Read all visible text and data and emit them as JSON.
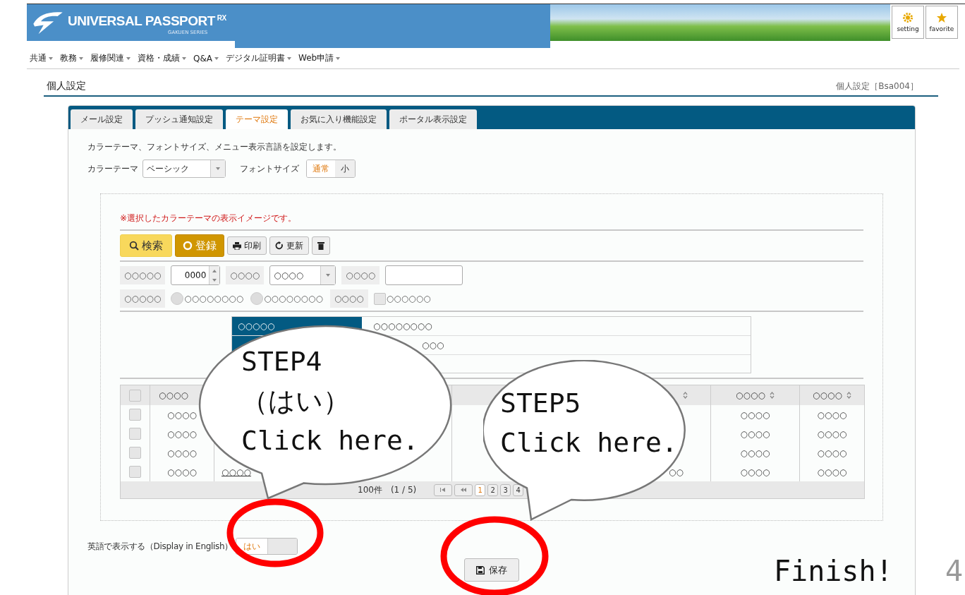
{
  "header": {
    "logo": "UNIVERSAL PASSPORT",
    "logo_sup": "RX",
    "logo_sub": "GAKUEN SERIES",
    "buttons": [
      {
        "label": "setting",
        "kind": "gear"
      },
      {
        "label": "favorite",
        "kind": "star"
      }
    ]
  },
  "menu": [
    "共通",
    "教務",
    "履修関連",
    "資格・成績",
    "Q&A",
    "デジタル証明書",
    "Web申請"
  ],
  "page": {
    "title": "個人設定",
    "screen_id": "個人設定［Bsa004］"
  },
  "tabs": [
    {
      "label": "メール設定",
      "selected": false
    },
    {
      "label": "プッシュ通知設定",
      "selected": false
    },
    {
      "label": "テーマ設定",
      "selected": true
    },
    {
      "label": "お気に入り機能設定",
      "selected": false
    },
    {
      "label": "ポータル表示設定",
      "selected": false
    }
  ],
  "description": "カラーテーマ、フォントサイズ、メニュー表示言語を設定します。",
  "color_theme": {
    "label": "カラーテーマ",
    "value": "ベーシック"
  },
  "font_size": {
    "label": "フォントサイズ",
    "options": [
      {
        "label": "通常",
        "selected": true
      },
      {
        "label": "小",
        "selected": false
      }
    ]
  },
  "preview": {
    "note": "※選択したカラーテーマの表示イメージです。",
    "buttons": [
      {
        "label": "検索",
        "kind": "search"
      },
      {
        "label": "登録",
        "kind": "register"
      },
      {
        "label": "印刷",
        "kind": "print"
      },
      {
        "label": "更新",
        "kind": "refresh"
      },
      {
        "kind": "delete"
      }
    ],
    "form_rows": [
      [
        {
          "kind": "label",
          "text": "○○○○○"
        },
        {
          "kind": "number",
          "text": "0000"
        },
        {
          "kind": "label",
          "text": "○○○○"
        },
        {
          "kind": "select",
          "text": "○○○○"
        },
        {
          "kind": "label",
          "text": "○○○○"
        },
        {
          "kind": "input"
        }
      ],
      [
        {
          "kind": "label",
          "text": "○○○○○"
        },
        {
          "kind": "radio",
          "text": "○○○○○○○○",
          "checked": false
        },
        {
          "kind": "radio",
          "text": "○○○○○○○○",
          "checked": false
        },
        {
          "kind": "label",
          "text": "○○○○"
        },
        {
          "kind": "checkbox",
          "text": "○○○○○○",
          "checked": false
        }
      ]
    ],
    "detail_table": [
      {
        "label": "○○○○○",
        "value": "○○○○○○○○"
      },
      {
        "value": "○○○"
      }
    ],
    "table": {
      "all_checked": false,
      "columns": [
        {
          "label": "○○○○",
          "sortable": false
        },
        {},
        {
          "sortable": true
        },
        {
          "label": "○○○○",
          "sortable": true
        },
        {
          "label": "○○○○",
          "sortable": true
        }
      ],
      "rows": [
        {
          "checked": false,
          "col1": "○○○○",
          "col4": "○○○○",
          "col5": "○○○○"
        },
        {
          "checked": false,
          "col1": "○○○○",
          "col4": "○○○○",
          "col5": "○○○○"
        },
        {
          "checked": false,
          "col1": "○○○○",
          "col4": "○○○○",
          "col5": "○○○○"
        },
        {
          "checked": false,
          "col1": "○○○○",
          "col2": "○○○○",
          "col3": "○○",
          "col4": "○○○○",
          "col5": "○○○○"
        }
      ],
      "count": "100件　(1 / 5)",
      "pages": [
        {
          "label": "1",
          "selected": true
        },
        {
          "label": "2",
          "selected": false
        },
        {
          "label": "3",
          "selected": false
        },
        {
          "label": "4",
          "selected": false
        }
      ]
    }
  },
  "english": {
    "label": "英語で表示する（Display in English）",
    "toggle_label": "はい",
    "on": true
  },
  "save": "保存",
  "annotations": [
    {
      "kind": "step4",
      "text": "STEP4\n（はい）\nClick here."
    },
    {
      "kind": "step5",
      "text": "STEP5\nClick here."
    }
  ],
  "finish": "Finish!",
  "page_number": "4"
}
